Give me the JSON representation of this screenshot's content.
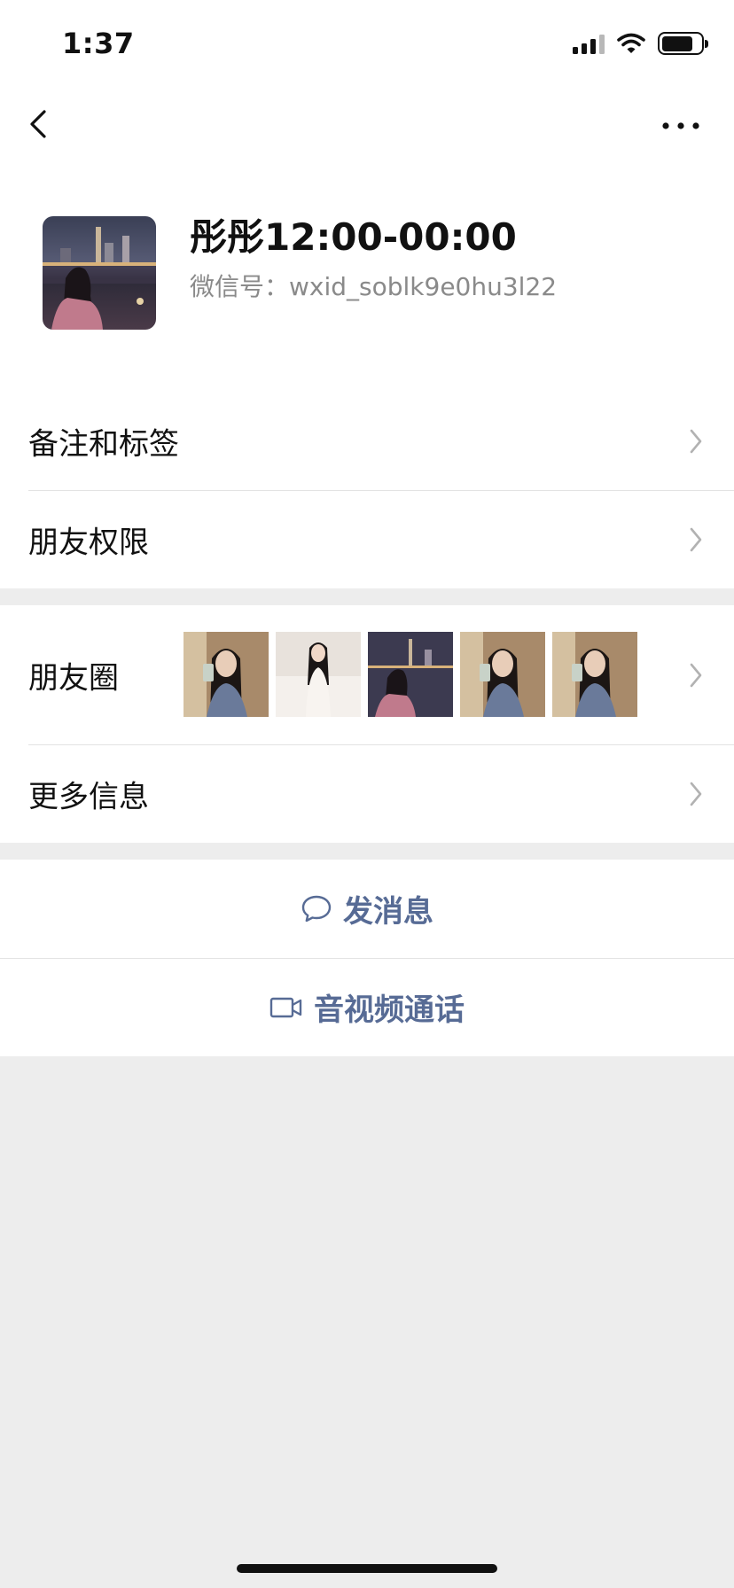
{
  "status_bar": {
    "time": "1:37",
    "signal_icon": "cellular-signal-icon",
    "wifi_icon": "wifi-icon",
    "battery_icon": "battery-icon",
    "battery_level": 0.8
  },
  "nav": {
    "back_icon": "chevron-left-icon",
    "more_icon": "more-horizontal-icon"
  },
  "profile": {
    "name": "彤彤12:00-00:00",
    "wechat_id": "微信号：wxid_soblk9e0hu3l22"
  },
  "cells": {
    "remark_tags": "备注和标签",
    "friend_permissions": "朋友权限",
    "moments": "朋友圈",
    "more_info": "更多信息"
  },
  "actions": {
    "send_message": "发消息",
    "av_call": "音视频通话"
  },
  "colors": {
    "link": "#576b95",
    "background": "#ededed",
    "separator": "#e3e3e3",
    "secondary_text": "#8a8a8a"
  }
}
